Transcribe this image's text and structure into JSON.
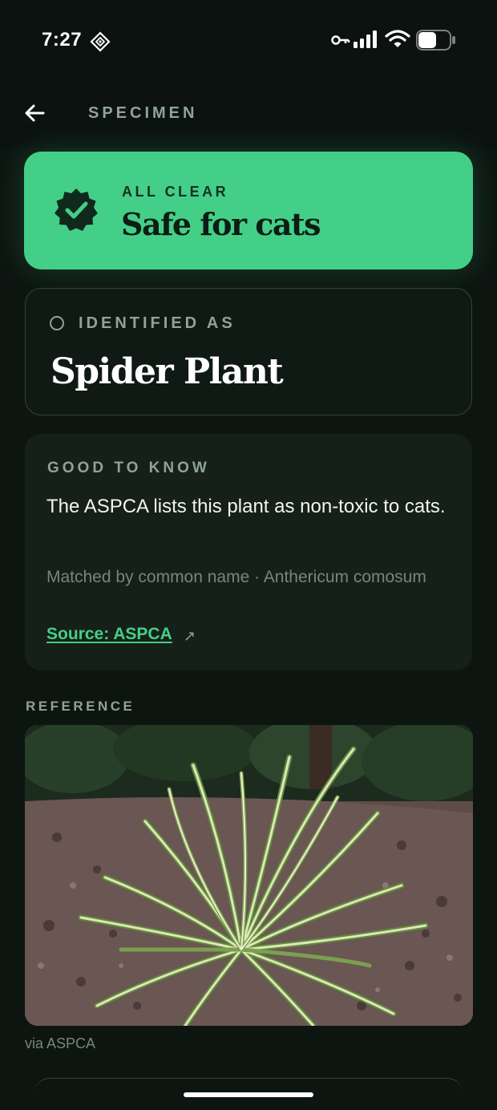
{
  "status_bar": {
    "time": "7:27",
    "icons": [
      "grid-diamond-icon",
      "key-icon",
      "signal-icon",
      "wifi-icon",
      "battery-icon"
    ]
  },
  "header": {
    "back_icon": "back-arrow-icon",
    "title": "SPECIMEN"
  },
  "safety": {
    "eyebrow": "ALL CLEAR",
    "title": "Safe for cats",
    "icon": "check-badge-icon",
    "color": "#44cf88"
  },
  "identification": {
    "label": "IDENTIFIED AS",
    "plant_name": "Spider Plant"
  },
  "good_to_know": {
    "label": "GOOD TO KNOW",
    "body": "The ASPCA lists this plant as non-toxic to cats.",
    "match_info": "Matched by common name · Anthericum comosum",
    "source_label": "Source: ASPCA",
    "source_icon": "external-link-icon"
  },
  "reference": {
    "label": "REFERENCE",
    "caption": "via ASPCA"
  },
  "colors": {
    "background": "#0d1511",
    "accent": "#44cf88",
    "muted_text": "#8fa496"
  }
}
